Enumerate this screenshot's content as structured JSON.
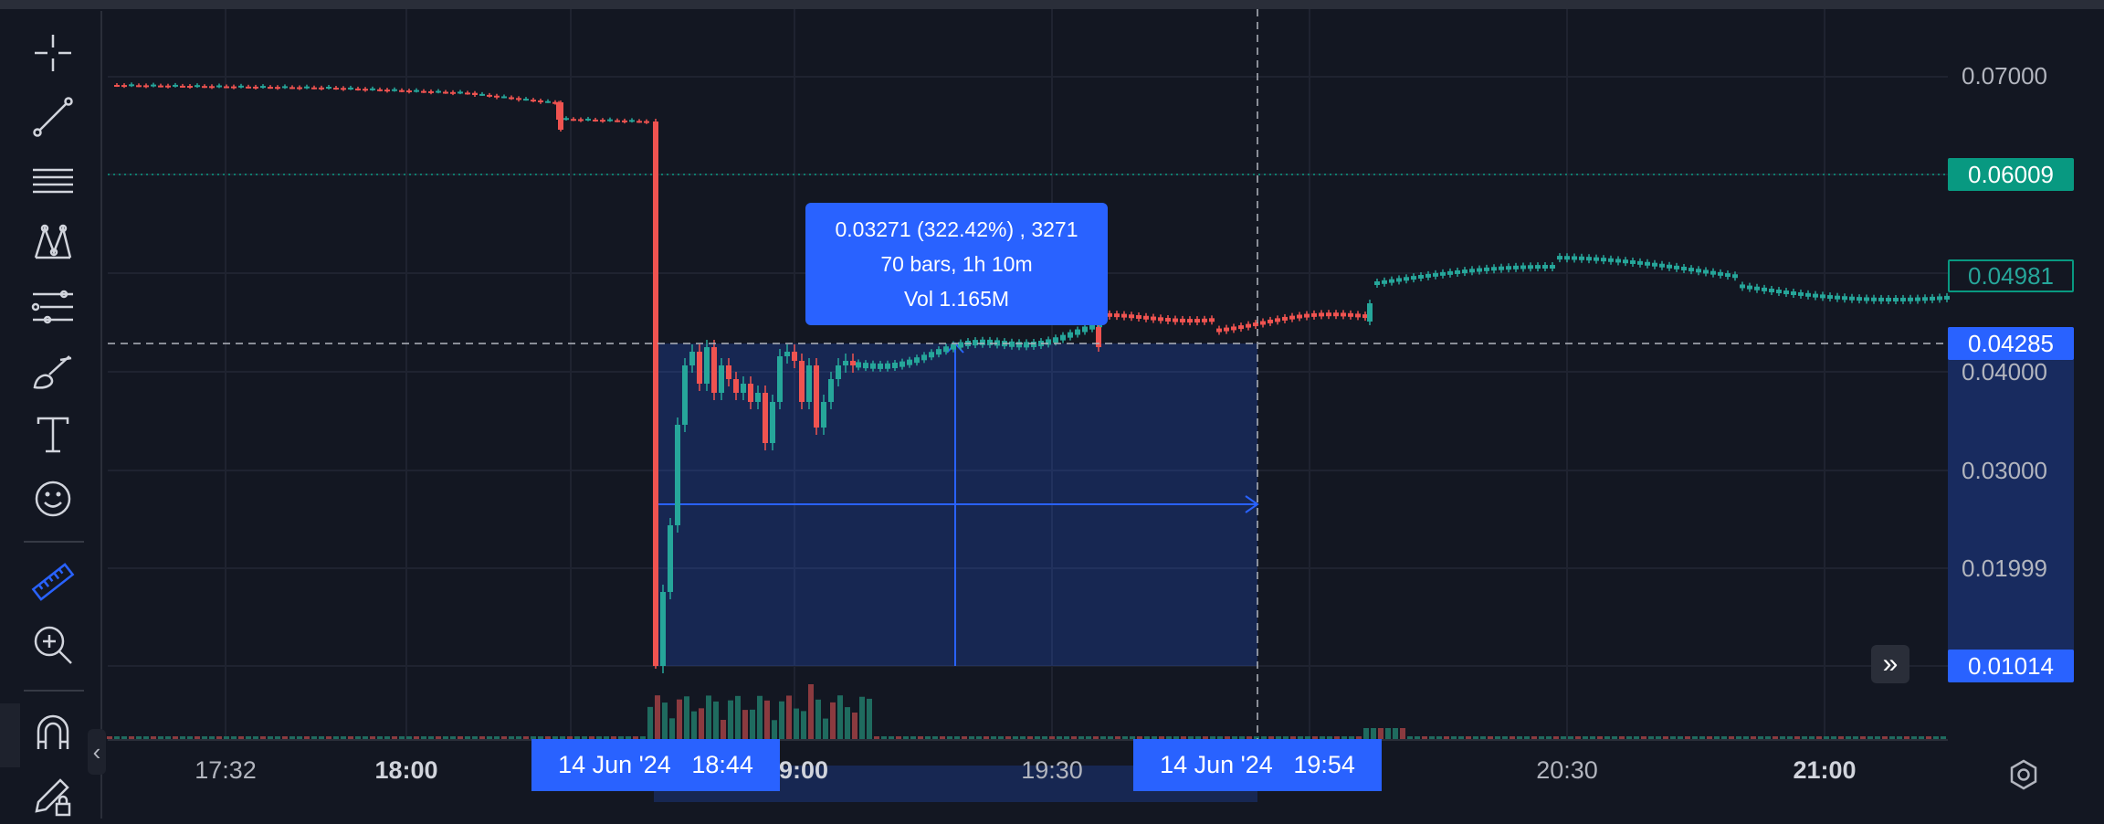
{
  "toolbar": {
    "tools": [
      {
        "name": "crosshair-icon"
      },
      {
        "name": "trend-line-icon"
      },
      {
        "name": "horizontal-lines-icon"
      },
      {
        "name": "pattern-icon"
      },
      {
        "name": "fib-levels-icon"
      },
      {
        "name": "brush-icon"
      },
      {
        "name": "text-icon"
      },
      {
        "name": "emoji-icon"
      },
      {
        "name": "ruler-icon"
      },
      {
        "name": "zoom-in-icon"
      },
      {
        "name": "magnet-icon"
      },
      {
        "name": "lock-pencil-icon"
      }
    ],
    "collapse_glyph": "‹"
  },
  "measure": {
    "line1": "0.03271 (322.42%) , 3271",
    "line2": "70 bars, 1h 10m",
    "line3": "Vol 1.165M",
    "start_date": "14 Jun '24",
    "start_time": "18:44",
    "end_date": "14 Jun '24",
    "end_time": "19:54"
  },
  "price_axis": {
    "labels": [
      "0.07000",
      "0.04000",
      "0.03000",
      "0.01999"
    ],
    "tags": {
      "prev_close": "0.06009",
      "last": "0.04981",
      "crosshair": "0.04285",
      "measure_low": "0.01014"
    }
  },
  "time_axis": {
    "labels": [
      {
        "text": "17:32",
        "bold": false
      },
      {
        "text": "18:00",
        "bold": true
      },
      {
        "text": "9:00",
        "bold": true
      },
      {
        "text": "19:30",
        "bold": false
      },
      {
        "text": "20:30",
        "bold": false
      },
      {
        "text": "21:00",
        "bold": true
      }
    ]
  },
  "colors": {
    "background": "#131722",
    "up": "#26a69a",
    "down": "#ef5350",
    "accent": "#2962ff",
    "green_tag": "#089981"
  },
  "jump_glyph": "»"
}
